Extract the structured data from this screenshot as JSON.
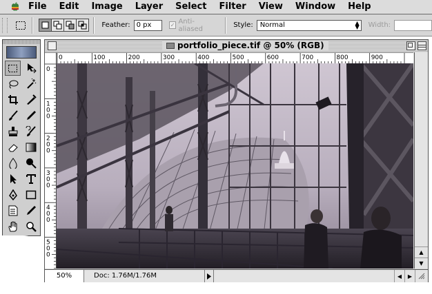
{
  "menubar": {
    "apple_icon": "apple-logo",
    "items": [
      "File",
      "Edit",
      "Image",
      "Layer",
      "Select",
      "Filter",
      "View",
      "Window",
      "Help"
    ]
  },
  "options": {
    "feather_label": "Feather:",
    "feather_value": "0 px",
    "antialiased_label": "Anti-aliased",
    "style_label": "Style:",
    "style_value": "Normal",
    "width_label": "Width:",
    "width_value": ""
  },
  "document": {
    "title": "portfolio_piece.tif @ 50% (RGB)",
    "ruler_top_labels": [
      "0",
      "100",
      "200",
      "300",
      "400",
      "500",
      "600",
      "700",
      "800",
      "900"
    ],
    "ruler_left_labels": [
      "0",
      "100",
      "200",
      "300",
      "400",
      "500"
    ],
    "zoom": "50%",
    "doc_size": "Doc: 1.76M/1.76M"
  },
  "tools": [
    "marquee-tool",
    "move-tool",
    "lasso-tool",
    "magic-wand-tool",
    "crop-tool",
    "eyedropper-slice-tool",
    "brush-tool",
    "pencil-tool",
    "stamp-tool",
    "history-brush-tool",
    "eraser-tool",
    "gradient-tool",
    "blur-tool",
    "dodge-tool",
    "path-select-tool",
    "type-tool",
    "pen-tool",
    "shape-tool",
    "notes-tool",
    "eyedropper-tool",
    "hand-tool",
    "zoom-tool"
  ]
}
